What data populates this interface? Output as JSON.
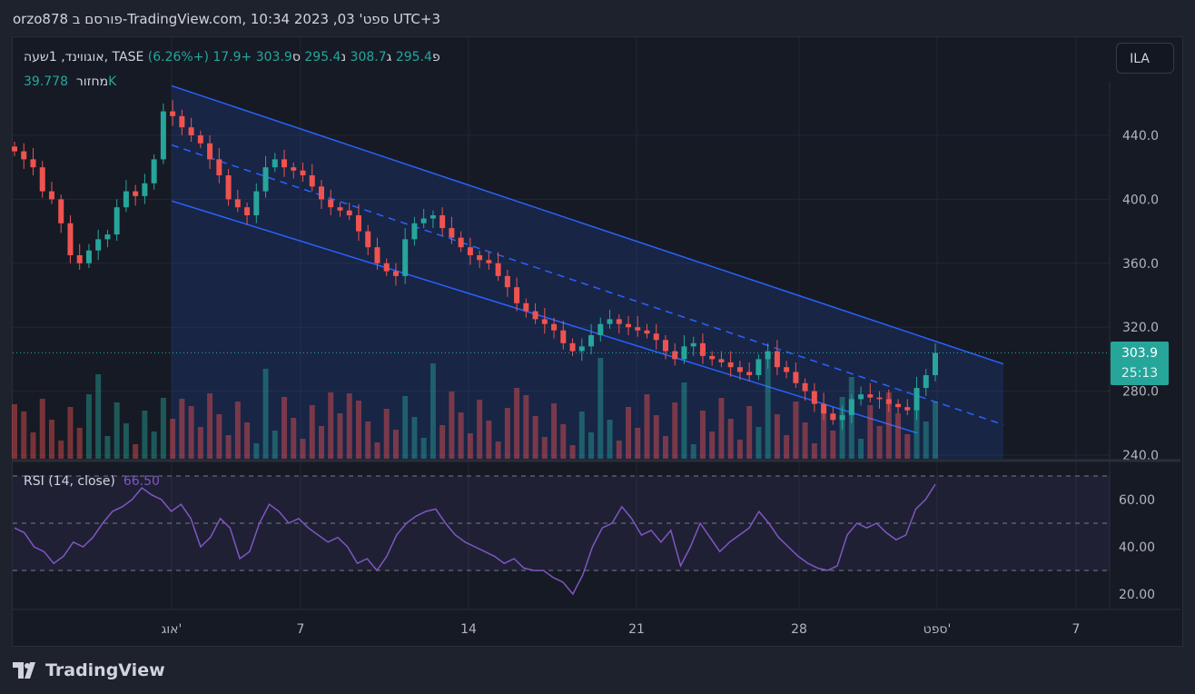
{
  "header": {
    "title": "orzo878 פורסם ב-TradingView.com, 10:34 2023 ,03 'ספט UTC+3"
  },
  "legend": {
    "symbol": "אוגווינד, 1שעה, TASE",
    "open_label": "פ",
    "open": "295.4",
    "high_label": "ג",
    "high": "308.7",
    "low_label": "נ",
    "low": "295.4",
    "close_label": "ס",
    "close": "303.9",
    "change": "+17.9 (+6.26%)",
    "volume_label": "מחזור",
    "volume": "39.778K",
    "rsi_label": "RSI (14, close)",
    "rsi_value": "66.50"
  },
  "currency_button": "ILA",
  "price_tag": {
    "price": "303.9",
    "countdown": "25:13"
  },
  "footer": {
    "brand": "TradingView"
  },
  "colors": {
    "up": "#26a69a",
    "down": "#ef5350",
    "channel": "#2962ff",
    "rsi": "#7e57c2"
  },
  "chart_data": [
    {
      "type": "candlestick",
      "title": "אוגווינד, 1שעה, TASE",
      "ylim": [
        232,
        475
      ],
      "yticks": [
        "440.0",
        "400.0",
        "360.0",
        "320.0",
        "280.0",
        "240.0"
      ],
      "ytick_values": [
        440,
        400,
        360,
        320,
        280,
        240
      ],
      "xticks": [
        "אוג'",
        "7",
        "14",
        "21",
        "28",
        "ספט'",
        "7"
      ],
      "closes": [
        430,
        425,
        420,
        405,
        400,
        385,
        365,
        360,
        368,
        375,
        378,
        395,
        405,
        402,
        410,
        425,
        455,
        452,
        445,
        440,
        435,
        425,
        415,
        400,
        395,
        390,
        405,
        420,
        425,
        420,
        418,
        415,
        408,
        400,
        395,
        393,
        390,
        380,
        370,
        360,
        355,
        352,
        375,
        385,
        388,
        390,
        382,
        376,
        370,
        365,
        362,
        360,
        352,
        345,
        335,
        330,
        325,
        322,
        318,
        310,
        305,
        308,
        315,
        322,
        325,
        322,
        320,
        318,
        316,
        312,
        305,
        300,
        308,
        310,
        302,
        300,
        298,
        295,
        292,
        290,
        300,
        305,
        295,
        292,
        285,
        280,
        272,
        266,
        262,
        265,
        275,
        278,
        276,
        275,
        272,
        270,
        268,
        282,
        290,
        303.9
      ],
      "channel": {
        "upper": [
          471,
          297
        ],
        "middle": [
          434,
          259
        ],
        "lower": [
          399,
          237
        ]
      },
      "volume_label": "39.778K"
    },
    {
      "type": "line",
      "title": "RSI (14, close)",
      "ylim": [
        14,
        80
      ],
      "yticks": [
        "60.00",
        "40.00",
        "20.00"
      ],
      "ytick_values": [
        60,
        40,
        20
      ],
      "bands": [
        70,
        50,
        30
      ],
      "values": [
        48,
        46,
        40,
        38,
        33,
        36,
        42,
        40,
        44,
        50,
        55,
        57,
        60,
        65,
        62,
        60,
        55,
        58,
        52,
        40,
        44,
        52,
        48,
        35,
        38,
        50,
        58,
        55,
        50,
        52,
        48,
        45,
        42,
        44,
        40,
        33,
        35,
        30,
        36,
        45,
        50,
        53,
        55,
        56,
        50,
        45,
        42,
        40,
        38,
        36,
        33,
        35,
        31,
        30,
        30,
        27,
        25,
        20,
        28,
        40,
        48,
        50,
        57,
        52,
        45,
        47,
        42,
        47,
        32,
        40,
        50,
        44,
        38,
        42,
        45,
        48,
        55,
        50,
        44,
        40,
        36,
        33,
        31,
        30,
        32,
        45,
        50,
        48,
        50,
        46,
        43,
        45,
        56,
        60,
        66.5
      ]
    }
  ]
}
